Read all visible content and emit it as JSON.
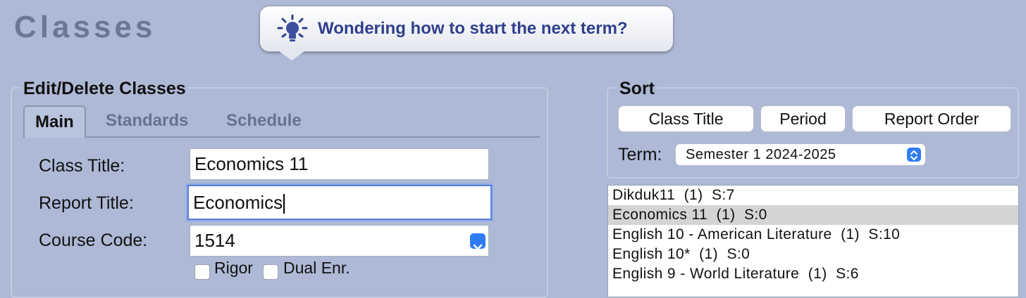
{
  "page": {
    "title": "Classes"
  },
  "hint": {
    "text": "Wondering how to start the next term?",
    "icon": "lightbulb-icon"
  },
  "edit": {
    "legend": "Edit/Delete Classes",
    "tabs": [
      {
        "label": "Main",
        "active": true
      },
      {
        "label": "Standards",
        "active": false
      },
      {
        "label": "Schedule",
        "active": false
      }
    ],
    "fields": {
      "class_title_label": "Class Title:",
      "class_title_value": "Economics 11",
      "report_title_label": "Report Title:",
      "report_title_value": "Economics",
      "course_code_label": "Course Code:",
      "course_code_value": "1514"
    },
    "checkboxes": {
      "rigor": "Rigor",
      "dual": "Dual Enr."
    }
  },
  "sort": {
    "legend": "Sort",
    "buttons": [
      "Class Title",
      "Period",
      "Report Order"
    ],
    "term_label": "Term:",
    "term_value": "Semester 1 2024-2025"
  },
  "class_list": {
    "selected_index": 1,
    "items": [
      "Dikduk11  (1)  S:7",
      "Economics 11  (1)  S:0",
      "English 10 - American Literature  (1)  S:10",
      "English 10*  (1)  S:0",
      "English 9 - World Literature  (1)  S:6"
    ]
  },
  "colors": {
    "background": "#adb9d6",
    "accent": "#2f7cf6",
    "hint_text": "#2f3f8e"
  }
}
